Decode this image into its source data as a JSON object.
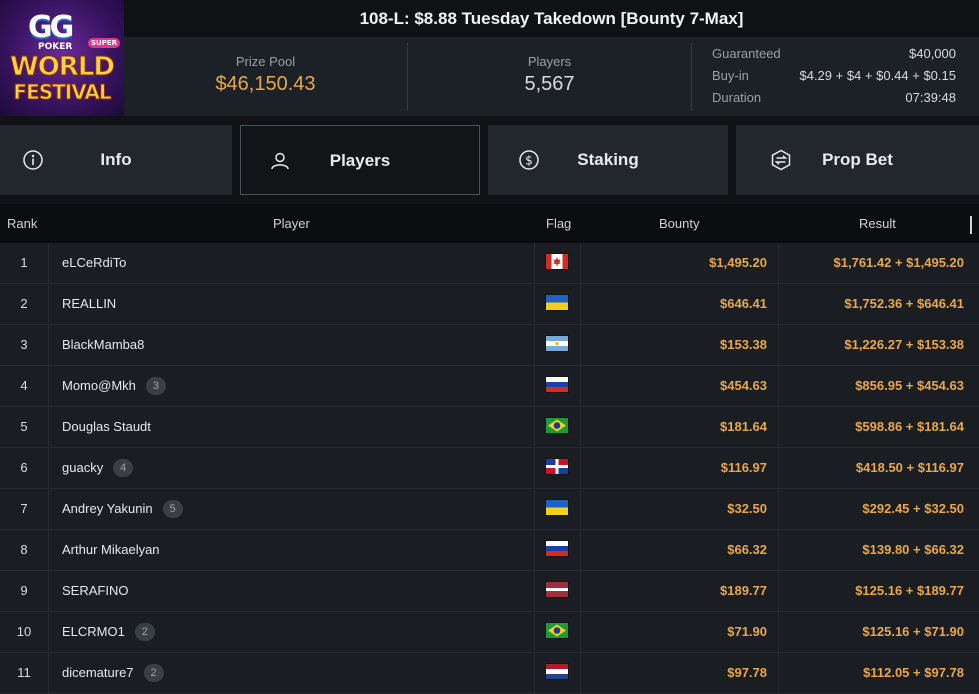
{
  "logo": {
    "line1": "GG",
    "line2": "POKER",
    "badge": "SUPER",
    "line3": "WORLD",
    "line4": "FESTIVAL"
  },
  "title": "108-L: $8.88 Tuesday Takedown [Bounty 7-Max]",
  "stats": {
    "prize_pool_label": "Prize Pool",
    "prize_pool_value": "$46,150.43",
    "players_label": "Players",
    "players_value": "5,567",
    "guaranteed_label": "Guaranteed",
    "guaranteed_value": "$40,000",
    "buyin_label": "Buy-in",
    "buyin_value": "$4.29 + $4 + $0.44 + $0.15",
    "duration_label": "Duration",
    "duration_value": "07:39:48"
  },
  "tabs": [
    {
      "label": "Info",
      "icon": "info-icon"
    },
    {
      "label": "Players",
      "icon": "user-icon"
    },
    {
      "label": "Staking",
      "icon": "dollar-icon"
    },
    {
      "label": "Prop Bet",
      "icon": "prop-bet-icon"
    }
  ],
  "active_tab": "Players",
  "table": {
    "columns": {
      "rank": "Rank",
      "player": "Player",
      "flag": "Flag",
      "bounty": "Bounty",
      "result": "Result"
    },
    "rows": [
      {
        "rank": "1",
        "player": "eLCeRdiTo",
        "badge": "",
        "flag": "canada",
        "bounty": "$1,495.20",
        "result": "$1,761.42 + $1,495.20"
      },
      {
        "rank": "2",
        "player": "REALLIN",
        "badge": "",
        "flag": "ukraine",
        "bounty": "$646.41",
        "result": "$1,752.36 + $646.41"
      },
      {
        "rank": "3",
        "player": "BlackMamba8",
        "badge": "",
        "flag": "argentina",
        "bounty": "$153.38",
        "result": "$1,226.27 + $153.38"
      },
      {
        "rank": "4",
        "player": "Momo@Mkh",
        "badge": "3",
        "flag": "russia",
        "bounty": "$454.63",
        "result": "$856.95 + $454.63"
      },
      {
        "rank": "5",
        "player": "Douglas Staudt",
        "badge": "",
        "flag": "brazil",
        "bounty": "$181.64",
        "result": "$598.86 + $181.64"
      },
      {
        "rank": "6",
        "player": "guacky",
        "badge": "4",
        "flag": "dominican-republic",
        "bounty": "$116.97",
        "result": "$418.50 + $116.97"
      },
      {
        "rank": "7",
        "player": "Andrey Yakunin",
        "badge": "5",
        "flag": "ukraine",
        "bounty": "$32.50",
        "result": "$292.45 + $32.50"
      },
      {
        "rank": "8",
        "player": "Arthur Mikaelyan",
        "badge": "",
        "flag": "russia",
        "bounty": "$66.32",
        "result": "$139.80 + $66.32"
      },
      {
        "rank": "9",
        "player": "SERAFINO",
        "badge": "",
        "flag": "latvia",
        "bounty": "$189.77",
        "result": "$125.16 + $189.77"
      },
      {
        "rank": "10",
        "player": "ELCRMO1",
        "badge": "2",
        "flag": "brazil",
        "bounty": "$71.90",
        "result": "$125.16 + $71.90"
      },
      {
        "rank": "11",
        "player": "dicemature7",
        "badge": "2",
        "flag": "netherlands",
        "bounty": "$97.78",
        "result": "$112.05 + $97.78"
      }
    ]
  },
  "colors": {
    "accent_gold": "#e8a84a",
    "background": "#101215",
    "panel": "#1c2027",
    "tab": "#22272e"
  }
}
